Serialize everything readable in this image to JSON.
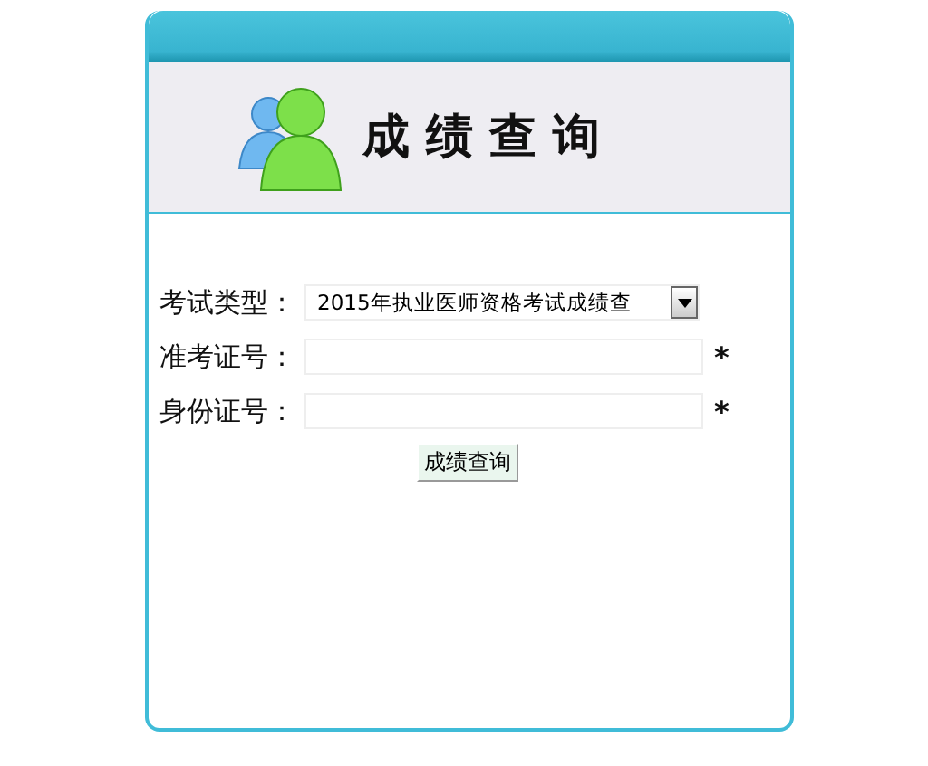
{
  "banner": {
    "title": "成 绩 查 询"
  },
  "form": {
    "fields": [
      {
        "kind": "select",
        "label": "考试类型：",
        "value": "2015年执业医师资格考试成绩查"
      },
      {
        "kind": "input",
        "label": "准考证号：",
        "required": "*"
      },
      {
        "kind": "input",
        "label": "身份证号：",
        "required": "*"
      }
    ],
    "button": "成绩查询"
  }
}
